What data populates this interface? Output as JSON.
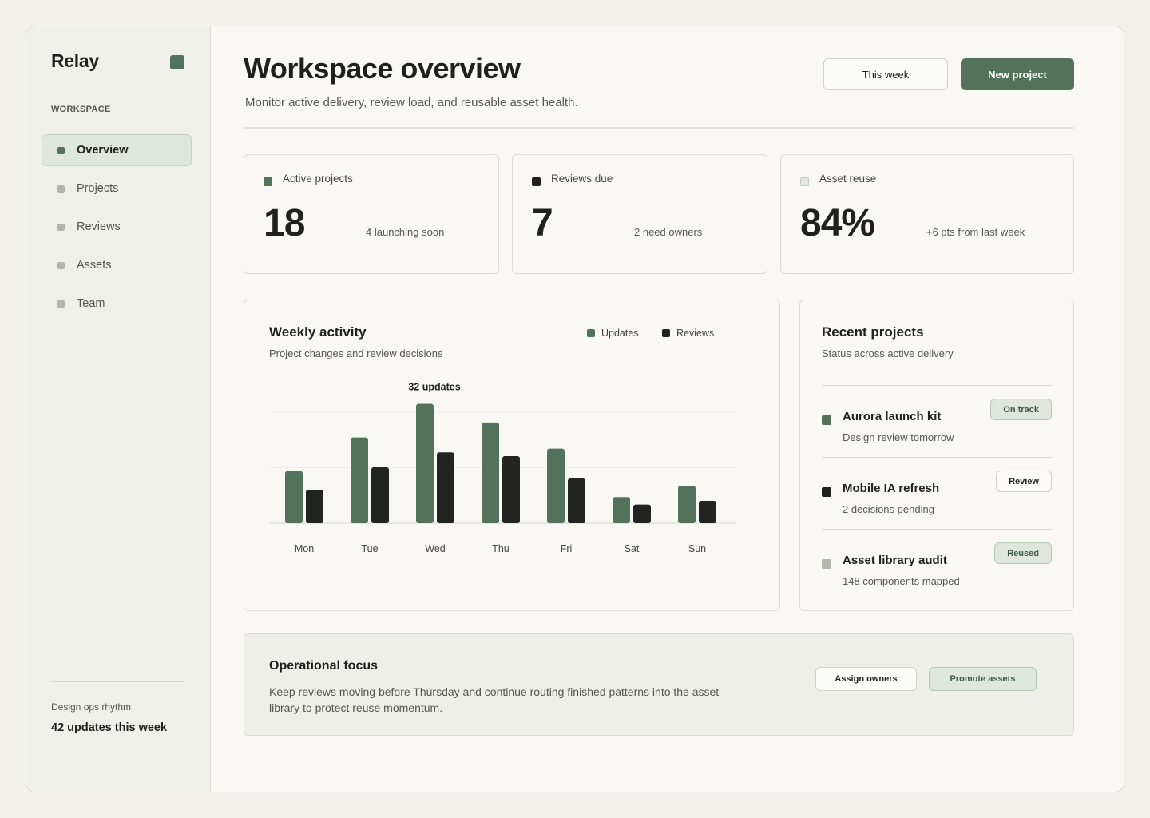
{
  "app": {
    "name": "Relay"
  },
  "sidebar": {
    "section": "WORKSPACE",
    "items": [
      {
        "label": "Overview",
        "active": true
      },
      {
        "label": "Projects",
        "active": false
      },
      {
        "label": "Reviews",
        "active": false
      },
      {
        "label": "Assets",
        "active": false
      },
      {
        "label": "Team",
        "active": false
      }
    ],
    "footer": {
      "label": "Design ops rhythm",
      "value": "42 updates this week"
    }
  },
  "header": {
    "title": "Workspace overview",
    "subtitle": "Monitor active delivery, review load, and reusable asset health.",
    "range_button": "This week",
    "new_button": "New project"
  },
  "stats": [
    {
      "label": "Active projects",
      "value": "18",
      "note": "4 launching soon",
      "color": "#52735a"
    },
    {
      "label": "Reviews due",
      "value": "7",
      "note": "2 need owners",
      "color": "#1f211e"
    },
    {
      "label": "Asset reuse",
      "value": "84%",
      "note": "+6 pts from last week",
      "color": "#e3e7e1"
    }
  ],
  "activity": {
    "title": "Weekly activity",
    "subtitle": "Project changes and review decisions",
    "annotation": "32 updates"
  },
  "chart_data": {
    "type": "bar",
    "categories": [
      "Mon",
      "Tue",
      "Wed",
      "Thu",
      "Fri",
      "Sat",
      "Sun"
    ],
    "series": [
      {
        "name": "Updates",
        "color": "#52735a",
        "values": [
          14,
          23,
          32,
          27,
          20,
          7,
          10
        ]
      },
      {
        "name": "Reviews",
        "color": "#222421",
        "values": [
          9,
          15,
          19,
          18,
          12,
          5,
          6
        ]
      }
    ],
    "ylim": [
      0,
      30
    ],
    "grid": true,
    "legend": "top-right",
    "annotations": [
      {
        "category": "Wed",
        "series": "Updates",
        "text": "32 updates"
      }
    ]
  },
  "recent": {
    "title": "Recent projects",
    "subtitle": "Status across active delivery",
    "items": [
      {
        "name": "Aurora launch kit",
        "meta": "Design review tomorrow",
        "badge": "On track",
        "dot": "#52735a",
        "badge_style": "green"
      },
      {
        "name": "Mobile IA refresh",
        "meta": "2 decisions pending",
        "badge": "Review",
        "dot": "#1f211e",
        "badge_style": "plain"
      },
      {
        "name": "Asset library audit",
        "meta": "148 components mapped",
        "badge": "Reused",
        "dot": "#b3b6ad",
        "badge_style": "green"
      }
    ]
  },
  "focus": {
    "title": "Operational focus",
    "text": "Keep reviews moving before Thursday and continue routing finished patterns into the asset library to protect reuse momentum.",
    "assign_button": "Assign owners",
    "promote_button": "Promote assets"
  }
}
